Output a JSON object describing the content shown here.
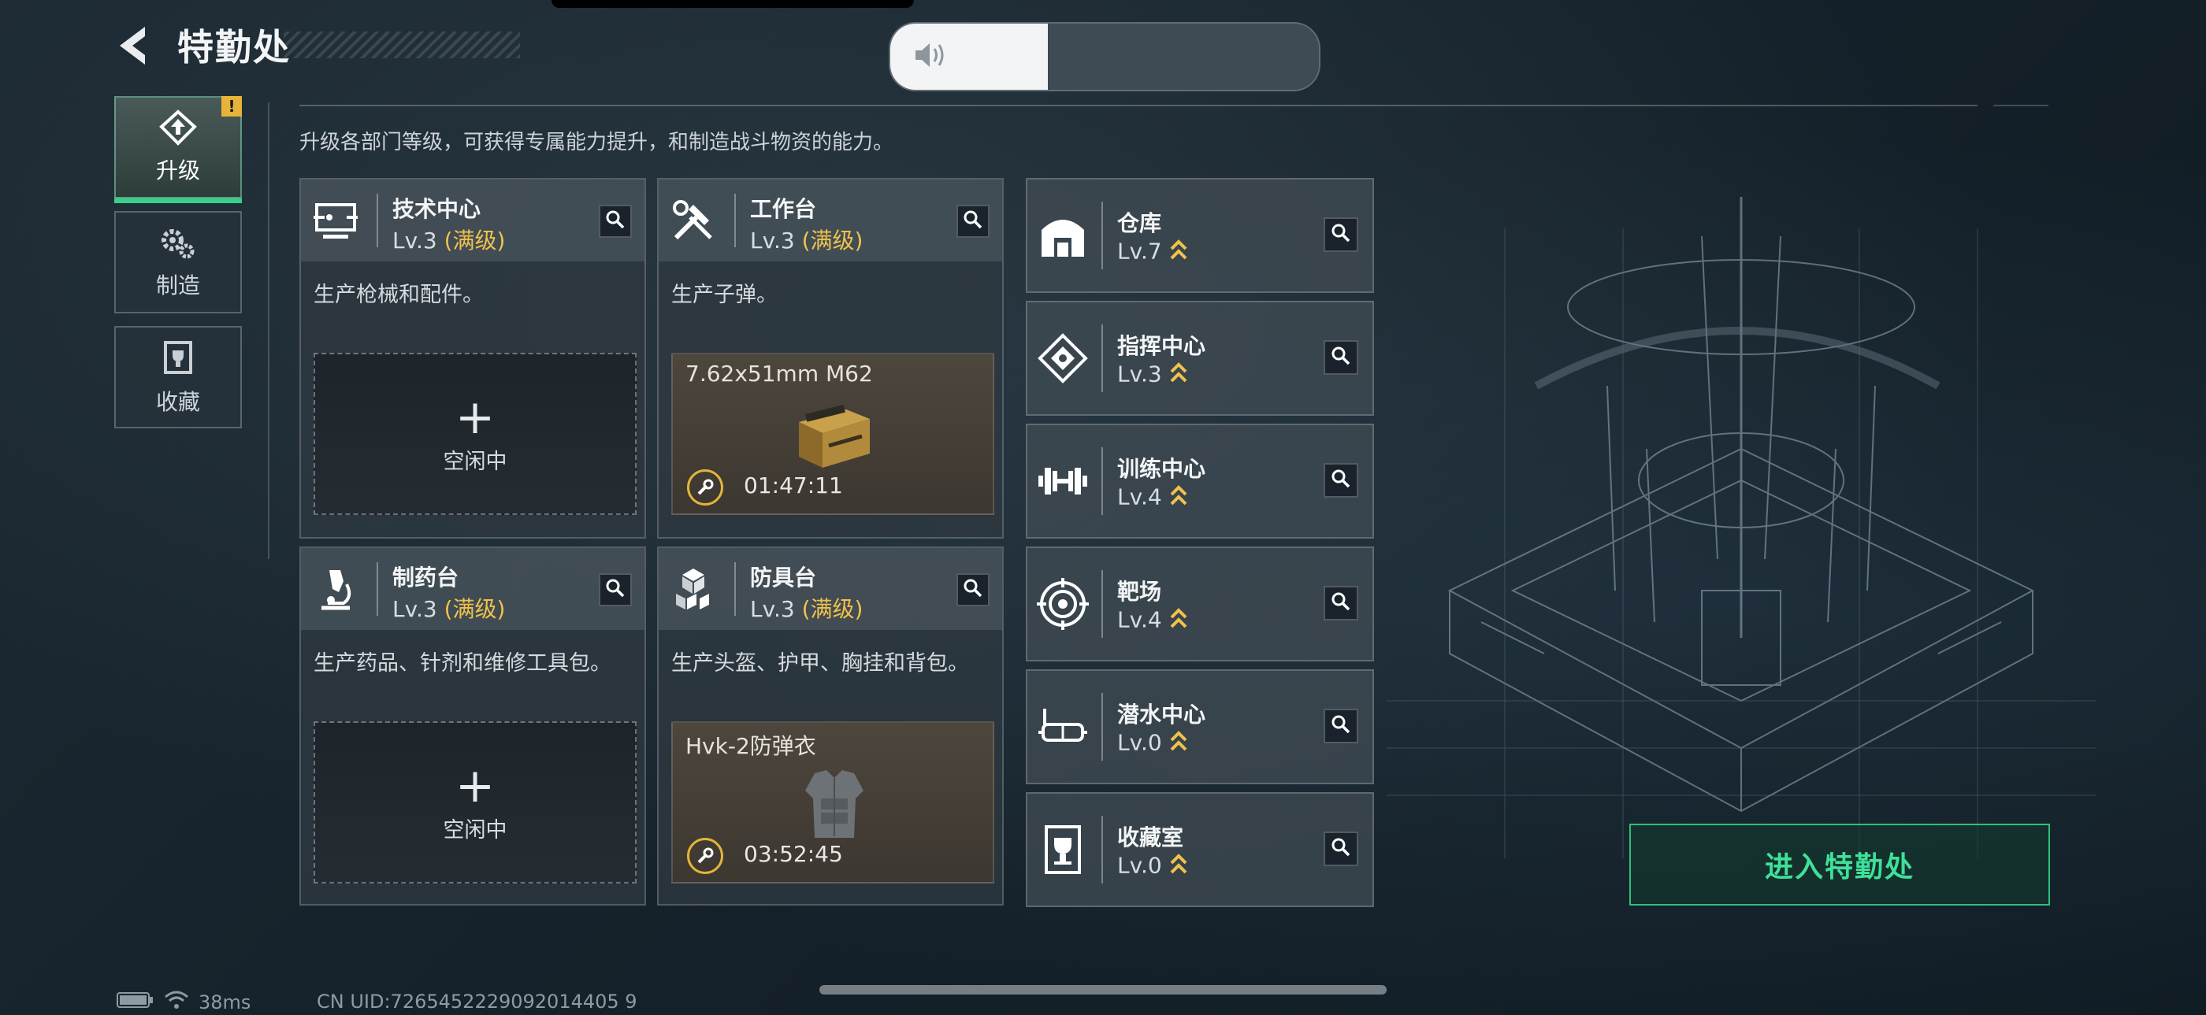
{
  "header": {
    "title": "特勤处"
  },
  "audio_toggle": {
    "state": "on"
  },
  "nav": [
    {
      "label": "升级",
      "active": true,
      "alert": "!"
    },
    {
      "label": "制造",
      "active": false
    },
    {
      "label": "收藏",
      "active": false
    }
  ],
  "description": "升级各部门等级，可获得专属能力提升，和制造战斗物资的能力。",
  "workshops": [
    {
      "name": "技术中心",
      "level": "Lv.3",
      "max": "(满级)",
      "desc": "生产枪械和配件。",
      "status": "空闲中"
    },
    {
      "name": "工作台",
      "level": "Lv.3",
      "max": "(满级)",
      "desc": "生产子弹。",
      "product": "7.62x51mm M62",
      "timer": "01:47:11"
    },
    {
      "name": "制药台",
      "level": "Lv.3",
      "max": "(满级)",
      "desc": "生产药品、针剂和维修工具包。",
      "status": "空闲中"
    },
    {
      "name": "防具台",
      "level": "Lv.3",
      "max": "(满级)",
      "desc": "生产头盔、护甲、胸挂和背包。",
      "product": "Hvk-2防弹衣",
      "timer": "03:52:45"
    }
  ],
  "facilities": [
    {
      "name": "仓库",
      "level": "Lv.7",
      "icon": "warehouse-icon"
    },
    {
      "name": "指挥中心",
      "level": "Lv.3",
      "icon": "command-center-icon"
    },
    {
      "name": "训练中心",
      "level": "Lv.4",
      "icon": "dumbbell-icon"
    },
    {
      "name": "靶场",
      "level": "Lv.4",
      "icon": "target-icon"
    },
    {
      "name": "潜水中心",
      "level": "Lv.0",
      "icon": "diving-mask-icon"
    },
    {
      "name": "收藏室",
      "level": "Lv.0",
      "icon": "collection-icon"
    }
  ],
  "enter_button": "进入特勤处",
  "status_bar": {
    "ping": "38ms",
    "uid": "CN UID:7265452229092014405 9"
  },
  "colors": {
    "accent_green": "#35d28a",
    "max_yellow": "#f1c24a"
  }
}
